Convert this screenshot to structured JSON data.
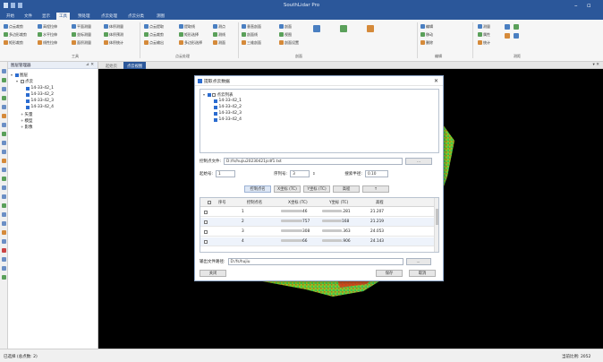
{
  "app": {
    "title": "SouthLidar Pro"
  },
  "menu": {
    "tabs": [
      "开始",
      "文件",
      "显示",
      "工具",
      "预处理",
      "点云处理",
      "点云分类",
      "测图"
    ],
    "active_index": 3
  },
  "ribbon": {
    "col1": [
      "点云裁剪",
      "多边形裁剪",
      "矩形裁剪"
    ],
    "col2": [
      "高程拉伸",
      "水平拉伸",
      "线性拉伸"
    ],
    "col3": [
      "平面测量",
      "坐标测量",
      "面积测量"
    ],
    "col4": [
      "体积测量",
      "体积预测",
      "体积统计"
    ],
    "group1_label": "工具",
    "col5": [
      "点云提取",
      "点云裁剪",
      "点云输出"
    ],
    "col6": [
      "提取线",
      "矩形选择",
      "多边形选择"
    ],
    "col7": [
      "测点",
      "测线",
      "测面"
    ],
    "group2_label": "点云处理",
    "col8": [
      "垂直剖面",
      "剖面线",
      "三维剖面"
    ],
    "col8b": [
      "剖面",
      "视图",
      "剖面设置"
    ],
    "group3_label": "剖面",
    "col9": [
      "编辑",
      "移动",
      "删除"
    ],
    "group4_label": "编辑",
    "col10": [
      "测量",
      "属性",
      "统计"
    ],
    "group5_label": "测距"
  },
  "layer_panel": {
    "title": "图层管理器",
    "root": "图层",
    "group": "点云",
    "items": [
      "14-33-42_1",
      "14-33-42_2",
      "14-33-42_3",
      "14-33-42_4"
    ],
    "other": [
      "矢量",
      "模型",
      "影像"
    ]
  },
  "doc_tabs": [
    "起始页",
    "点云视图"
  ],
  "dialog": {
    "title": "提取点云数据",
    "tree_root": "点云列表",
    "tree_items": [
      "14-33-42_1",
      "14-33-42_2",
      "14-33-42_3",
      "14-33-42_4"
    ],
    "file_label": "控制点文件:",
    "file_value": "D:/fs/hujiu20230421jcdf1.txt",
    "browse_label": "...",
    "start_label": "起始号:",
    "start_value": "1",
    "step_label": "序列号:",
    "step_value": "3",
    "range_label": "搜索半径:",
    "range_value": "0.10",
    "buttons": [
      "控制点名",
      "X坐标 (TC)",
      "Y坐标 (TC)",
      "高程",
      "↑"
    ],
    "table_headers": [
      "",
      "序号",
      "控制点名",
      "X坐标 (TC)",
      "Y坐标 (TC)",
      "高程"
    ],
    "rows": [
      {
        "index": "1",
        "x_tail": "46",
        "y_tail": ".281",
        "z": "21.207"
      },
      {
        "index": "2",
        "x_tail": "757",
        "y_tail": "168",
        "z": "21.219"
      },
      {
        "index": "3",
        "x_tail": "308",
        "y_tail": ".363",
        "z": "24.053"
      },
      {
        "index": "4",
        "x_tail": "66",
        "y_tail": ".906",
        "z": "24.143"
      }
    ],
    "output_label": "输出文件路径:",
    "output_value": "D:/fs/hujiu",
    "output_browse": "...",
    "close_label": "关闭",
    "save_label": "保存",
    "cancel_label": "取消"
  },
  "status": {
    "left": "已选择 (总点数: 2)",
    "right": "当前比例: 2052"
  },
  "colors": {
    "accent": "#2b579a",
    "selection": "#2b6cd0",
    "viewport": "#000000"
  }
}
